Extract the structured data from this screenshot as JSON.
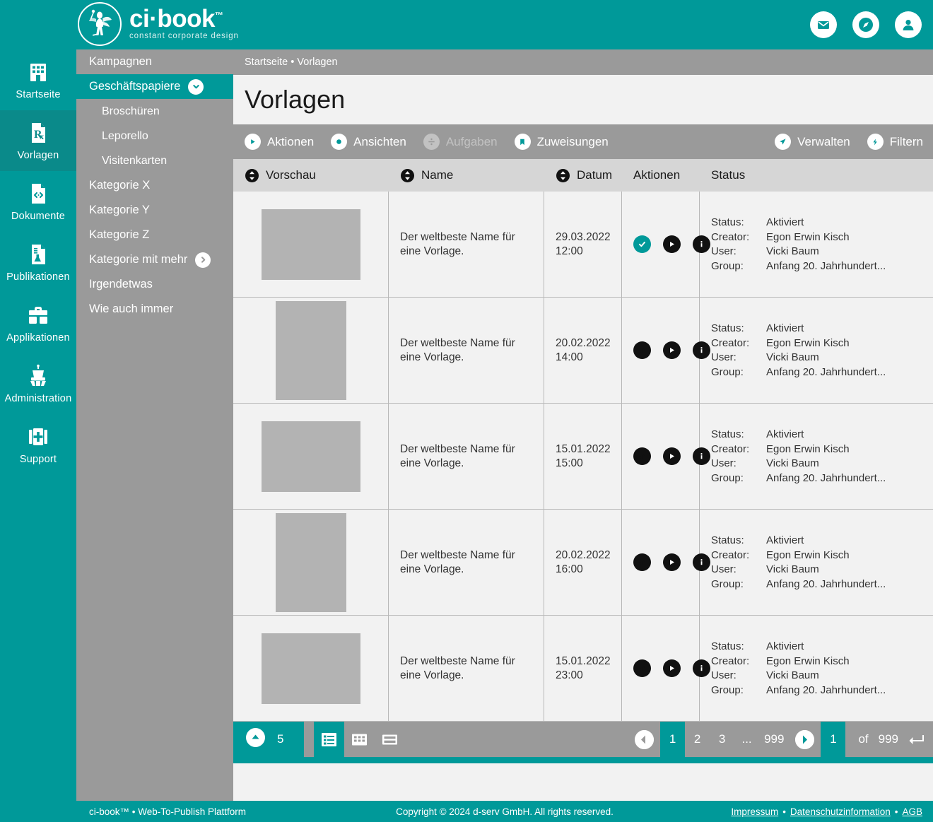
{
  "brand": {
    "name": "ci·book",
    "tm": "™",
    "tagline": "constant corporate design",
    "logo_icon": "fairy-logo-icon",
    "accent_color": "#009999",
    "gray_color": "#9a9a9a"
  },
  "topbar": {
    "icons": [
      {
        "name": "mail-icon",
        "label": "Nachrichten"
      },
      {
        "name": "compass-icon",
        "label": "Navigation"
      },
      {
        "name": "user-account-icon",
        "label": "Benutzerkonto"
      }
    ]
  },
  "rail": {
    "items": [
      {
        "label": "Startseite",
        "icon": "building-icon",
        "active": false
      },
      {
        "label": "Vorlagen",
        "icon": "template-rx-icon",
        "active": true
      },
      {
        "label": "Dokumente",
        "icon": "code-document-icon",
        "active": false
      },
      {
        "label": "Publikationen",
        "icon": "flask-document-icon",
        "active": false
      },
      {
        "label": "Applikationen",
        "icon": "toolbox-icon",
        "active": false
      },
      {
        "label": "Administration",
        "icon": "control-tower-icon",
        "active": false
      },
      {
        "label": "Support",
        "icon": "first-aid-kit-icon",
        "active": false
      }
    ]
  },
  "subnav": {
    "items": [
      {
        "label": "Kampagnen",
        "level": 0,
        "active": false,
        "badge": null
      },
      {
        "label": "Geschäftspapiere",
        "level": 0,
        "active": true,
        "badge": "chevron-down-icon"
      },
      {
        "label": "Broschüren",
        "level": 1,
        "active": false,
        "badge": null
      },
      {
        "label": "Leporello",
        "level": 1,
        "active": false,
        "badge": null
      },
      {
        "label": "Visitenkarten",
        "level": 1,
        "active": false,
        "badge": null
      },
      {
        "label": "Kategorie X",
        "level": 0,
        "active": false,
        "badge": null
      },
      {
        "label": "Kategorie Y",
        "level": 0,
        "active": false,
        "badge": null
      },
      {
        "label": "Kategorie Z",
        "level": 0,
        "active": false,
        "badge": null
      },
      {
        "label": "Kategorie mit mehr",
        "level": 0,
        "active": false,
        "badge": "chevron-right-icon"
      },
      {
        "label": "Irgendetwas",
        "level": 0,
        "active": false,
        "badge": null
      },
      {
        "label": "Wie auch immer",
        "level": 0,
        "active": false,
        "badge": null
      }
    ]
  },
  "breadcrumb": "Startseite • Vorlagen",
  "page_title": "Vorlagen",
  "toolbar": {
    "left": [
      {
        "label": "Aktionen",
        "icon": "play-circle-icon",
        "disabled": false
      },
      {
        "label": "Ansichten",
        "icon": "record-circle-icon",
        "disabled": false
      },
      {
        "label": "Aufgaben",
        "icon": "divide-circle-icon",
        "disabled": true
      },
      {
        "label": "Zuweisungen",
        "icon": "bookmark-icon",
        "disabled": false
      }
    ],
    "right": [
      {
        "label": "Verwalten",
        "icon": "paper-plane-icon",
        "disabled": false
      },
      {
        "label": "Filtern",
        "icon": "bolt-icon",
        "disabled": false
      }
    ]
  },
  "table": {
    "columns": [
      {
        "label": "Vorschau",
        "sortable": true
      },
      {
        "label": "Name",
        "sortable": true
      },
      {
        "label": "Datum",
        "sortable": true
      },
      {
        "label": "Aktionen",
        "sortable": false
      },
      {
        "label": "Status",
        "sortable": false
      }
    ],
    "status_keys": {
      "status": "Status:",
      "creator": "Creator:",
      "user": "User:",
      "group": "Group:"
    },
    "rows": [
      {
        "thumb": "landscape",
        "name": "Der weltbeste Name für eine Vorlage.",
        "date": "29.03.2022\n12:00",
        "actions": [
          {
            "name": "check-icon",
            "highlight": true
          },
          {
            "name": "play-icon",
            "highlight": false
          },
          {
            "name": "info-icon",
            "highlight": false
          }
        ],
        "status": "Aktiviert",
        "creator": "Egon Erwin Kisch",
        "user": "Vicki Baum",
        "group": "Anfang 20. Jahrhundert..."
      },
      {
        "thumb": "portrait",
        "name": "Der weltbeste Name für eine Vorlage.",
        "date": "20.02.2022\n14:00",
        "actions": [
          {
            "name": "check-icon",
            "highlight": false
          },
          {
            "name": "play-icon",
            "highlight": false
          },
          {
            "name": "info-icon",
            "highlight": false
          }
        ],
        "status": "Aktiviert",
        "creator": "Egon Erwin Kisch",
        "user": "Vicki Baum",
        "group": "Anfang 20. Jahrhundert..."
      },
      {
        "thumb": "landscape",
        "name": "Der weltbeste Name für eine Vorlage.",
        "date": "15.01.2022\n15:00",
        "actions": [
          {
            "name": "check-icon",
            "highlight": false
          },
          {
            "name": "play-icon",
            "highlight": false
          },
          {
            "name": "info-icon",
            "highlight": false
          }
        ],
        "status": "Aktiviert",
        "creator": "Egon Erwin Kisch",
        "user": "Vicki Baum",
        "group": "Anfang 20. Jahrhundert..."
      },
      {
        "thumb": "portrait",
        "name": "Der weltbeste Name für eine Vorlage.",
        "date": "20.02.2022\n16:00",
        "actions": [
          {
            "name": "check-icon",
            "highlight": false
          },
          {
            "name": "play-icon",
            "highlight": false
          },
          {
            "name": "info-icon",
            "highlight": false
          }
        ],
        "status": "Aktiviert",
        "creator": "Egon Erwin Kisch",
        "user": "Vicki Baum",
        "group": "Anfang 20. Jahrhundert..."
      },
      {
        "thumb": "landscape",
        "name": "Der weltbeste Name für eine Vorlage.",
        "date": "15.01.2022\n23:00",
        "actions": [
          {
            "name": "check-icon",
            "highlight": false
          },
          {
            "name": "play-icon",
            "highlight": false
          },
          {
            "name": "info-icon",
            "highlight": false
          }
        ],
        "status": "Aktiviert",
        "creator": "Egon Erwin Kisch",
        "user": "Vicki Baum",
        "group": "Anfang 20. Jahrhundert..."
      }
    ]
  },
  "pager": {
    "per_page": "5",
    "per_page_icon": "chevron-up-circle-icon",
    "views": [
      {
        "name": "list-view-icon",
        "active": true
      },
      {
        "name": "grid-view-icon",
        "active": false
      },
      {
        "name": "detail-view-icon",
        "active": false
      }
    ],
    "prev_icon": "arrow-left-circle-icon",
    "next_icon": "arrow-right-circle-icon",
    "pages": [
      {
        "label": "1",
        "active": true,
        "dots": false
      },
      {
        "label": "2",
        "active": false,
        "dots": false
      },
      {
        "label": "3",
        "active": false,
        "dots": false
      },
      {
        "label": "...",
        "active": false,
        "dots": true
      },
      {
        "label": "999",
        "active": false,
        "dots": false
      }
    ],
    "current_page": "1",
    "of_label": "of",
    "total_pages": "999",
    "enter_icon": "enter-key-icon"
  },
  "footer": {
    "left": "ci-book™ • Web-To-Publish Plattform",
    "copyright": "Copyright © 2024 d-serv GmbH. All rights reserved.",
    "links": [
      {
        "label": "Impressum"
      },
      {
        "label": "Datenschutzinformation"
      },
      {
        "label": "AGB"
      }
    ],
    "separator": "•"
  }
}
